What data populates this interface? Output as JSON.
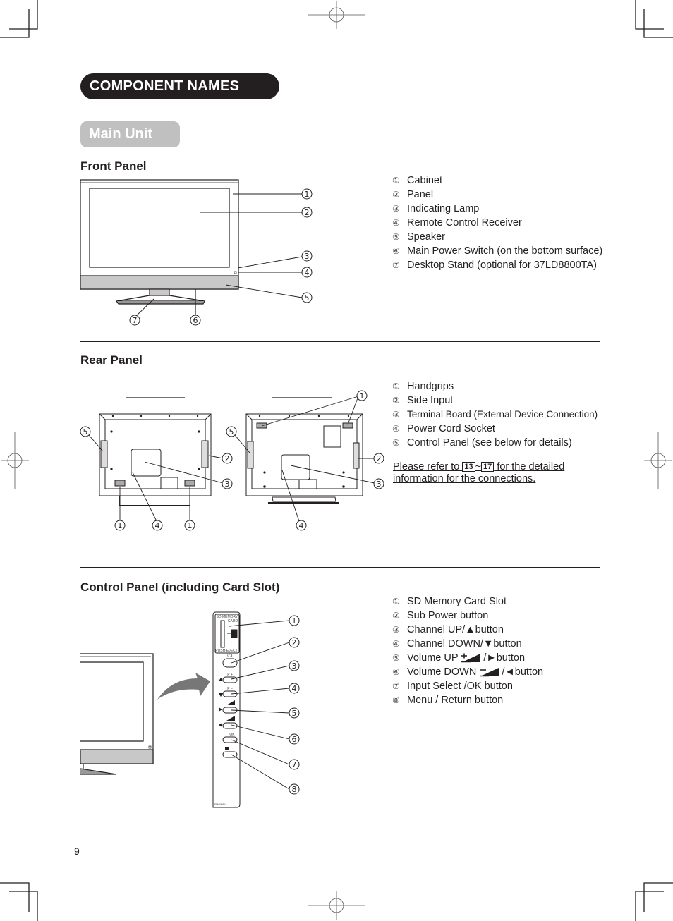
{
  "page": {
    "title": "COMPONENT NAMES",
    "subtitle": "Main Unit",
    "page_number": "9"
  },
  "front_panel": {
    "heading": "Front Panel",
    "callouts": [
      "1",
      "2",
      "3",
      "4",
      "5",
      "6",
      "7"
    ],
    "items": [
      {
        "num": "①",
        "label": "Cabinet"
      },
      {
        "num": "②",
        "label": "Panel"
      },
      {
        "num": "③",
        "label": "Indicating Lamp"
      },
      {
        "num": "④",
        "label": "Remote Control Receiver"
      },
      {
        "num": "⑤",
        "label": "Speaker"
      },
      {
        "num": "⑥",
        "label": "Main Power Switch (on the bottom surface)"
      },
      {
        "num": "⑦",
        "label": "Desktop Stand (optional for 37LD8800TA)"
      }
    ]
  },
  "rear_panel": {
    "heading": "Rear Panel",
    "callouts": [
      "1",
      "2",
      "3",
      "4",
      "5"
    ],
    "items": [
      {
        "num": "①",
        "label": "Handgrips"
      },
      {
        "num": "②",
        "label": "Side Input"
      },
      {
        "num": "③",
        "label": "Terminal Board (External Device Connection)"
      },
      {
        "num": "④",
        "label": "Power Cord Socket"
      },
      {
        "num": "⑤",
        "label": "Control Panel (see below for details)"
      }
    ],
    "note": {
      "prefix": "Please refer to ",
      "page_from": "13",
      "separator": "~",
      "page_to": "17",
      "suffix": " for the detailed",
      "line2": "information for the connections."
    }
  },
  "control_panel": {
    "heading": "Control Panel (including Card Slot)",
    "callouts": [
      "1",
      "2",
      "3",
      "4",
      "5",
      "6",
      "7",
      "8"
    ],
    "panel_labels": {
      "sd_card": "SD MEMORY",
      "card": "CARD",
      "push_eject": "PUSH-EJECT",
      "power": "⏻I",
      "p_plus": "P +",
      "p_minus": "P –",
      "ok": "OK",
      "model_code": "PW38814"
    },
    "items": [
      {
        "num": "①",
        "label": "SD Memory Card Slot"
      },
      {
        "num": "②",
        "label": "Sub Power button"
      },
      {
        "num": "③",
        "label": "Channel UP/",
        "glyph": "▲",
        "suffix": "button"
      },
      {
        "num": "④",
        "label": "Channel DOWN/",
        "glyph": "▼",
        "suffix": "button"
      },
      {
        "num": "⑤",
        "label": "Volume UP ",
        "vol_icon": "volume-up-icon",
        "glyph": " /►",
        "suffix": "button"
      },
      {
        "num": "⑥",
        "label": "Volume DOWN ",
        "vol_icon": "volume-down-icon",
        "glyph": " /◄",
        "suffix": "button"
      },
      {
        "num": "⑦",
        "label": "Input Select /OK button"
      },
      {
        "num": "⑧",
        "label": "Menu / Return button"
      }
    ]
  }
}
